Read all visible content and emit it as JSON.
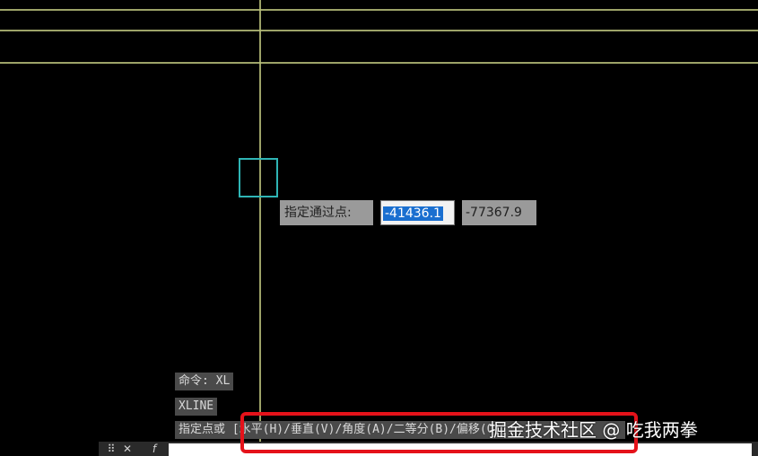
{
  "dynamic_input": {
    "label": "指定通过点:",
    "x_value": "-41436.1",
    "y_value": "-77367.9"
  },
  "command_history": {
    "line1": "命令: XL",
    "line2": "XLINE",
    "line3": "指定点或 [水平(H)/垂直(V)/角度(A)/二等分(B)/偏移(O)]:"
  },
  "command_line": {
    "grip_icon": "⠿",
    "close_icon": "✕",
    "fx_icon": "f",
    "input_value": ""
  },
  "watermark": "掘金技术社区 @ 吃我两拳",
  "colors": {
    "construction_line": "#b9c07a",
    "pickbox": "#2fb5b5",
    "highlight_box": "#e5121a",
    "selection": "#1a6fd0"
  }
}
